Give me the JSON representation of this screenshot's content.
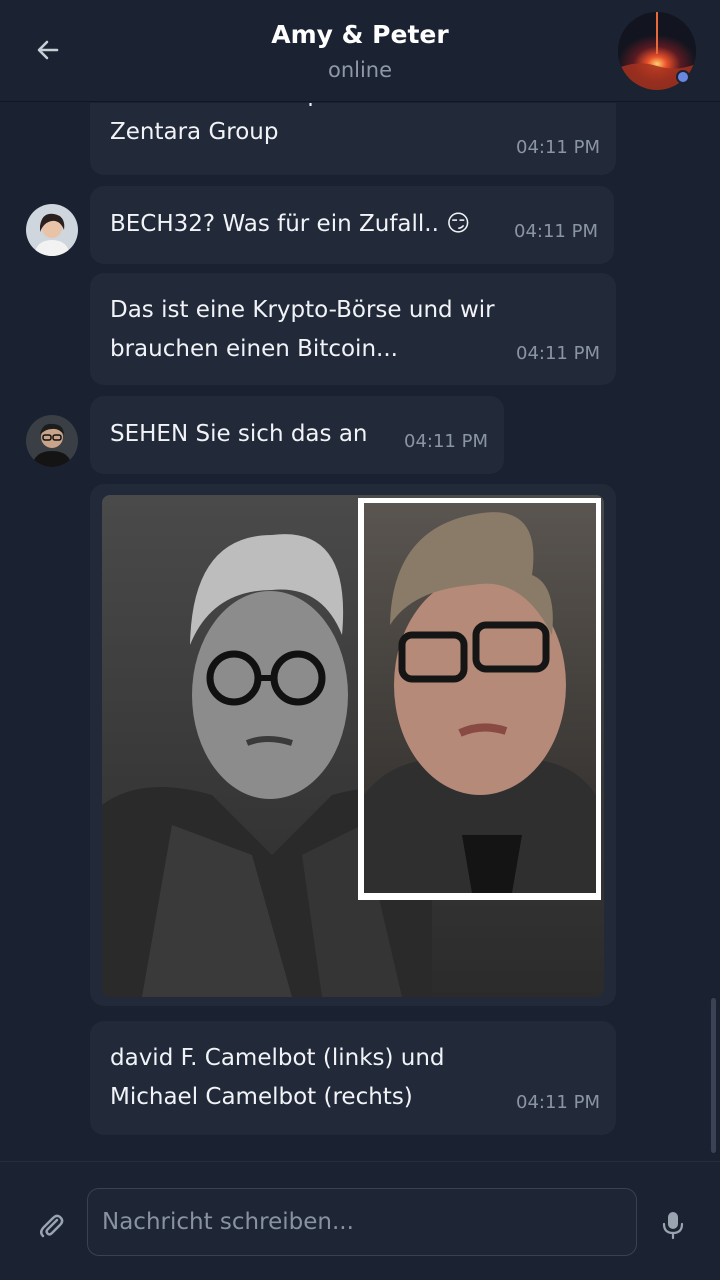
{
  "header": {
    "title": "Amy & Peter",
    "status": "online"
  },
  "messages": [
    {
      "text_lines": [
        "Besitzer und Hauptaktionär der",
        "Zentara Group"
      ],
      "time": "04:11 PM"
    },
    {
      "text_lines": [
        "BECH32? Was für ein Zufall.."
      ],
      "emoji": "😏",
      "time": "04:11 PM"
    },
    {
      "text_lines": [
        "Das ist eine Krypto-Börse und wir",
        "brauchen einen Bitcoin..."
      ],
      "time": "04:11 PM"
    },
    {
      "text_lines": [
        "SEHEN Sie sich das an"
      ],
      "time": "04:11 PM"
    },
    {
      "text_lines": [
        "david F. Camelbot (links) und",
        "Michael Camelbot (rechts)"
      ],
      "time": "04:11 PM"
    }
  ],
  "composer": {
    "placeholder": "Nachricht schreiben..."
  },
  "icons": {
    "back": "arrow-left-icon",
    "attach": "paperclip-icon",
    "mic": "microphone-icon"
  },
  "colors": {
    "background": "#1a2130",
    "bubble": "#222a3a",
    "online_dot": "#6a88e0"
  }
}
